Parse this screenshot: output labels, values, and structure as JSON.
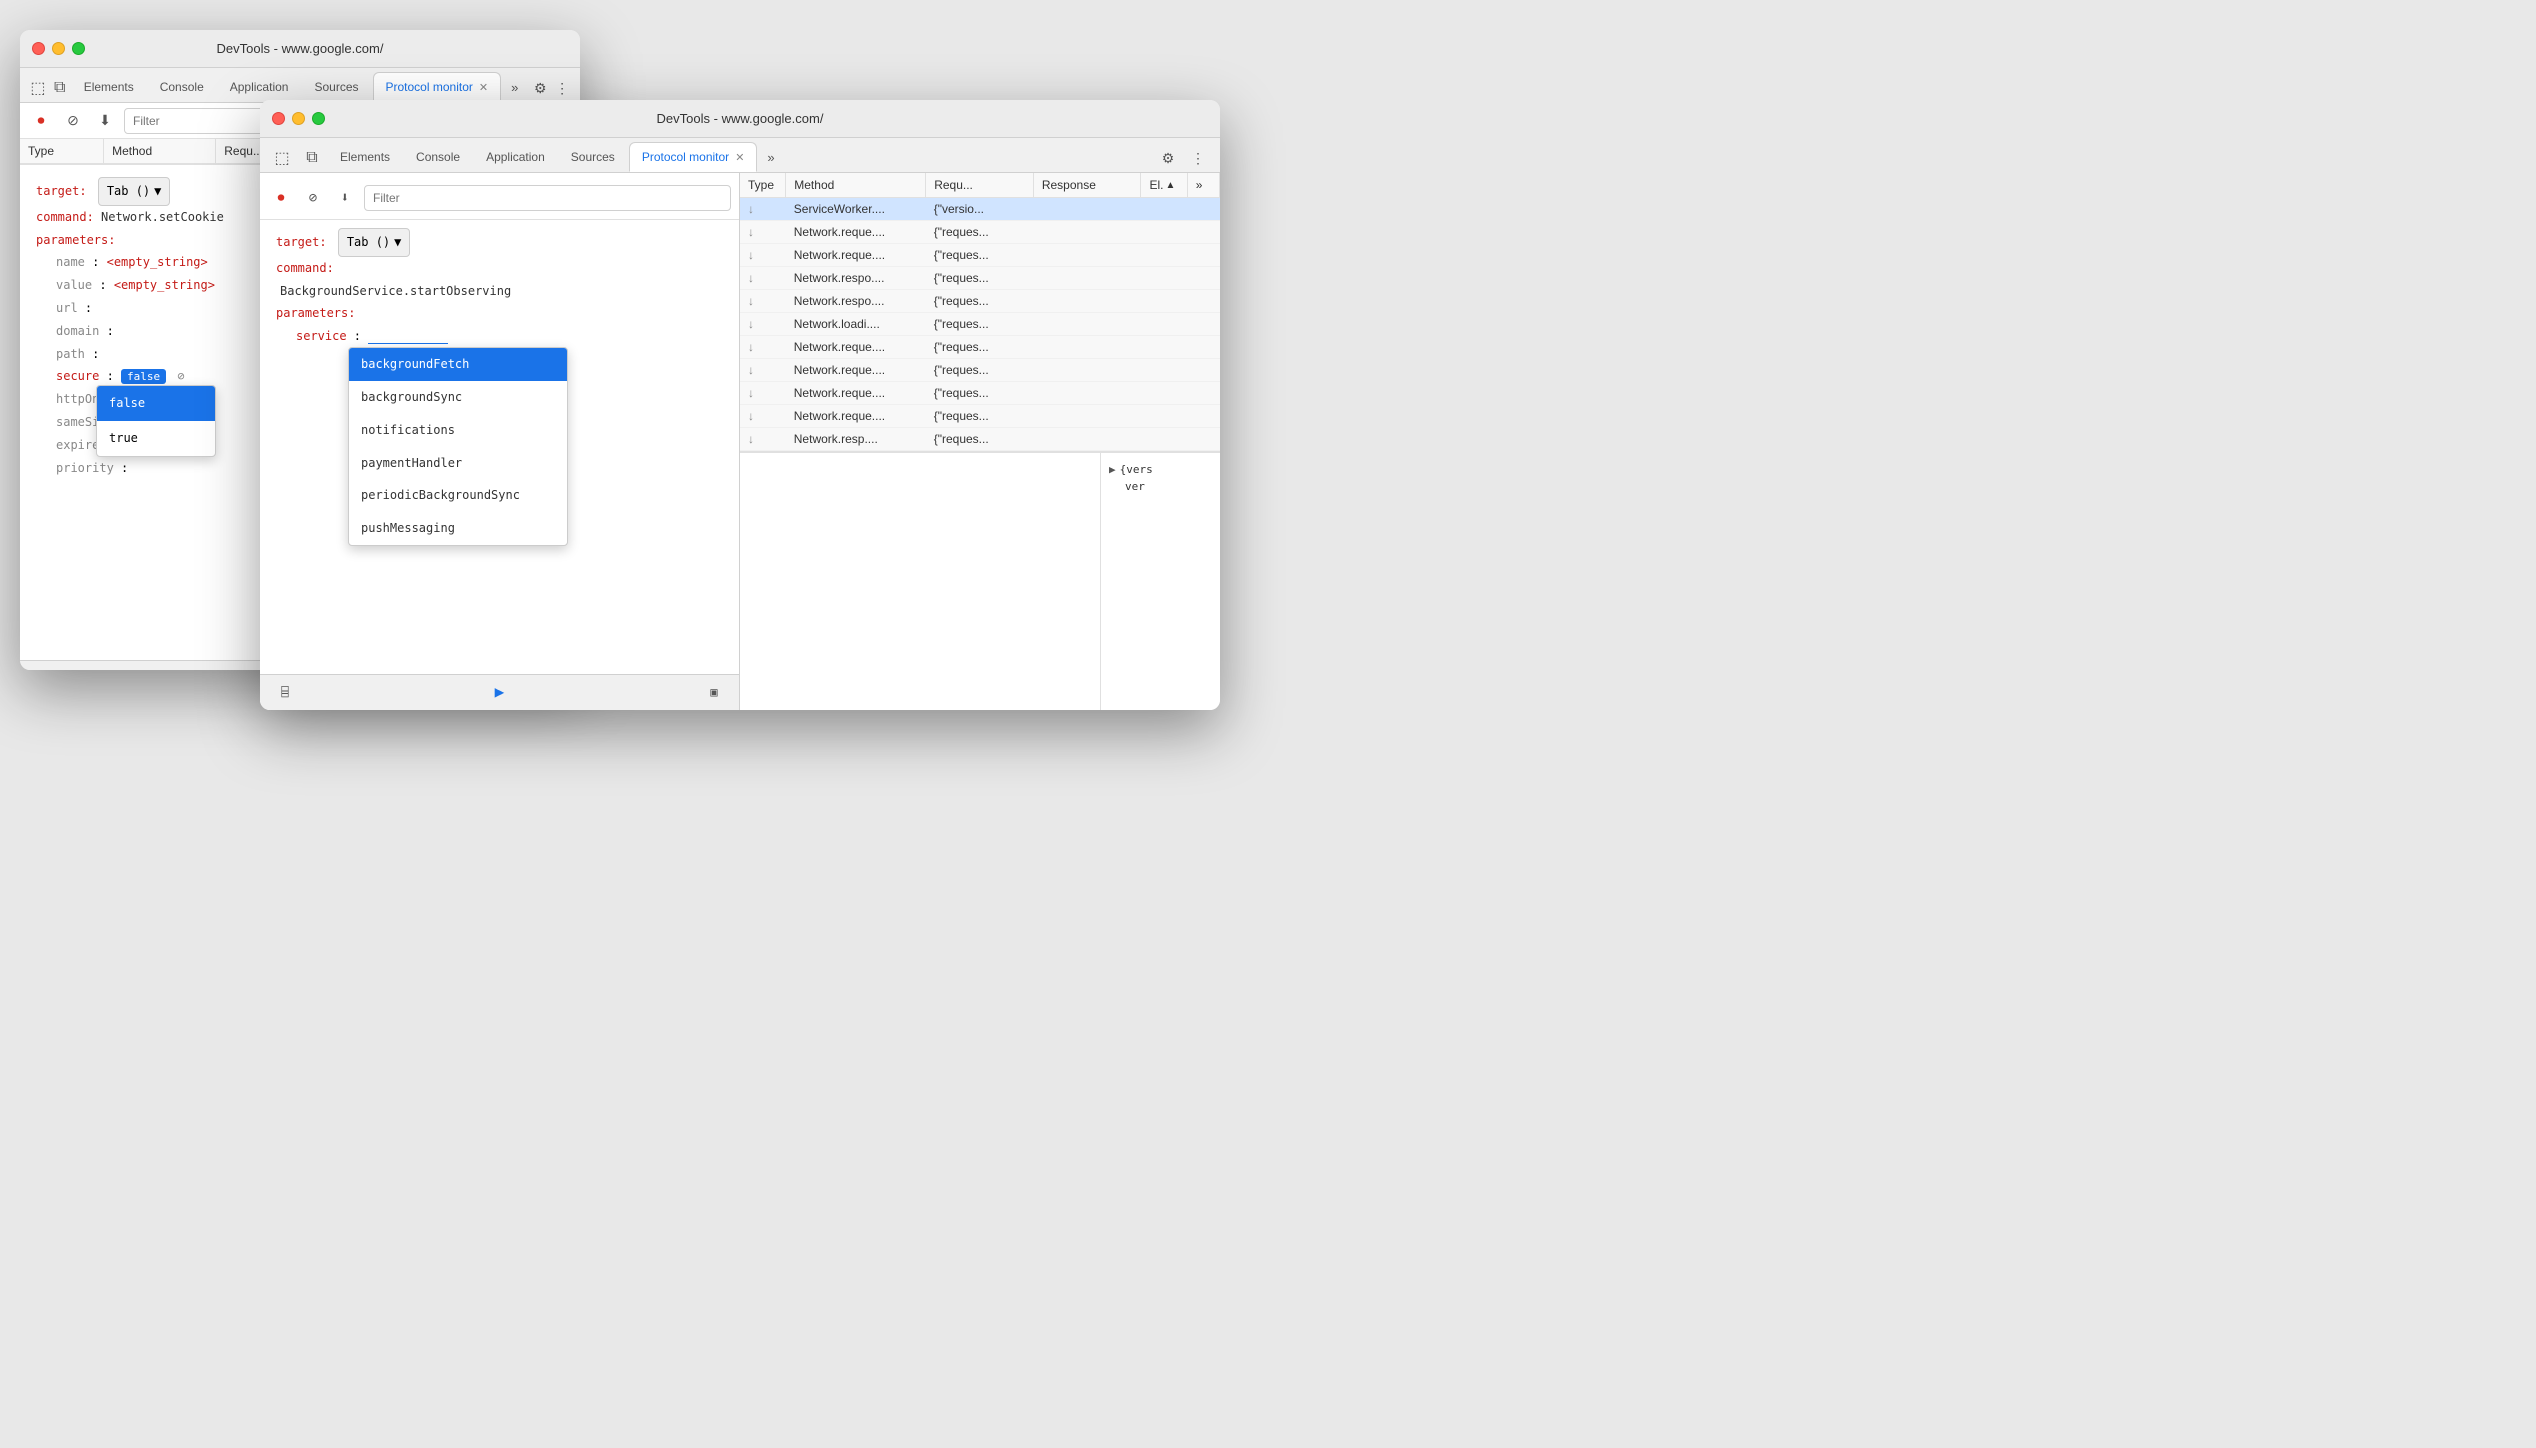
{
  "windows": {
    "back": {
      "title": "DevTools - www.google.com/",
      "target_label": "target:",
      "target_value": "Tab ()",
      "command_label": "command:",
      "command_value": "Network.setCookie",
      "parameters_label": "parameters:",
      "fields": [
        {
          "key": "name",
          "value": "<empty_string>",
          "is_string": true
        },
        {
          "key": "value",
          "value": "<empty_string>",
          "is_string": true
        },
        {
          "key": "url",
          "value": ""
        },
        {
          "key": "domain",
          "value": ""
        },
        {
          "key": "path",
          "value": ""
        },
        {
          "key": "secure",
          "value": "false",
          "has_dropdown": true,
          "dropdown_open": true
        },
        {
          "key": "httpOnly",
          "value": ""
        },
        {
          "key": "sameSite",
          "value": ""
        },
        {
          "key": "expires",
          "value": ""
        },
        {
          "key": "priority",
          "value": ""
        }
      ],
      "dropdown_options": [
        "false",
        "true"
      ],
      "selected_option": "false",
      "tabs": [
        {
          "label": "Elements",
          "active": false
        },
        {
          "label": "Console",
          "active": false
        },
        {
          "label": "Application",
          "active": false
        },
        {
          "label": "Sources",
          "active": false
        },
        {
          "label": "Protocol monitor",
          "active": true,
          "closeable": true
        }
      ],
      "filter_placeholder": "Filter",
      "table_headers": [
        "Type",
        "Method",
        "Requ...",
        "Response",
        "El.▲",
        ">>"
      ],
      "table_rows": []
    },
    "front": {
      "title": "DevTools - www.google.com/",
      "target_label": "target:",
      "target_value": "Tab ()",
      "command_label": "command:",
      "command_value": "BackgroundService.startObserving",
      "parameters_label": "parameters:",
      "service_label": "service",
      "service_value": "",
      "autocomplete_options": [
        {
          "label": "backgroundFetch",
          "selected": true
        },
        {
          "label": "backgroundSync",
          "selected": false
        },
        {
          "label": "notifications",
          "selected": false
        },
        {
          "label": "paymentHandler",
          "selected": false
        },
        {
          "label": "periodicBackgroundSync",
          "selected": false
        },
        {
          "label": "pushMessaging",
          "selected": false
        }
      ],
      "tabs": [
        {
          "label": "Elements",
          "active": false
        },
        {
          "label": "Console",
          "active": false
        },
        {
          "label": "Application",
          "active": false
        },
        {
          "label": "Sources",
          "active": false
        },
        {
          "label": "Protocol monitor",
          "active": true,
          "closeable": true
        }
      ],
      "filter_placeholder": "Filter",
      "table_headers": [
        "Type",
        "Method",
        "Requ...",
        "Response",
        "El.▲"
      ],
      "table_rows": [
        {
          "type": "↓",
          "method": "ServiceWorker....",
          "request": "{\"versio...",
          "response": "",
          "el": "",
          "highlight": true
        },
        {
          "type": "↓",
          "method": "Network.reque....",
          "request": "{\"reques...",
          "response": "",
          "el": ""
        },
        {
          "type": "↓",
          "method": "Network.reque....",
          "request": "{\"reques...",
          "response": "",
          "el": ""
        },
        {
          "type": "↓",
          "method": "Network.respo....",
          "request": "{\"reques...",
          "response": "",
          "el": ""
        },
        {
          "type": "↓",
          "method": "Network.respo....",
          "request": "{\"reques...",
          "response": "",
          "el": ""
        },
        {
          "type": "↓",
          "method": "Network.loadi....",
          "request": "{\"reques...",
          "response": "",
          "el": ""
        },
        {
          "type": "↓",
          "method": "Network.reque....",
          "request": "{\"reques...",
          "response": "",
          "el": ""
        },
        {
          "type": "↓",
          "method": "Network.reque....",
          "request": "{\"reques...",
          "response": "",
          "el": ""
        },
        {
          "type": "↓",
          "method": "Network.reque....",
          "request": "{\"reques...",
          "response": "",
          "el": ""
        },
        {
          "type": "↓",
          "method": "Network.reque....",
          "request": "{\"reques...",
          "response": "",
          "el": ""
        },
        {
          "type": "↓",
          "method": "Network.resp....",
          "request": "{\"reques...",
          "response": "",
          "el": ""
        }
      ],
      "json_tree": [
        {
          "label": "▶ {vers",
          "indent": 0
        },
        {
          "label": "ver",
          "indent": 1
        }
      ]
    }
  },
  "icons": {
    "stop": "⏹",
    "clear": "⊘",
    "download": "↓",
    "send": "▶",
    "dock": "⌸",
    "more": "⋮",
    "settings": "⚙",
    "inspect": "⬚",
    "layers": "⧉",
    "chevron": "»",
    "more_tabs": "»"
  }
}
